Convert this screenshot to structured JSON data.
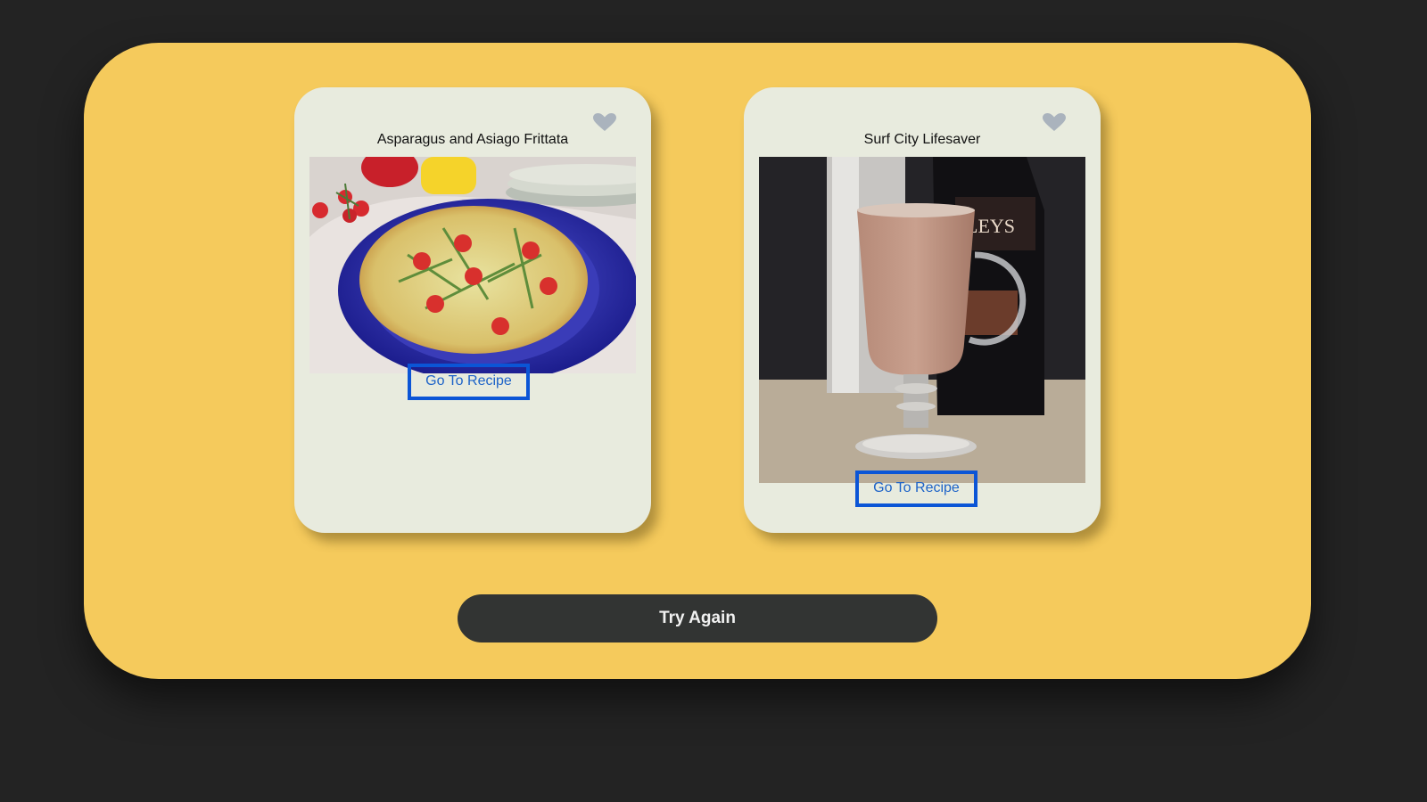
{
  "cards": [
    {
      "title": "Asparagus and Asiago Frittata",
      "link_label": "Go To Recipe",
      "icon": "heart-icon"
    },
    {
      "title": "Surf City Lifesaver",
      "link_label": "Go To Recipe",
      "icon": "heart-icon"
    }
  ],
  "actions": {
    "try_again_label": "Try Again"
  },
  "colors": {
    "background": "#232323",
    "panel": "#f5ca5c",
    "card": "#e8ebde",
    "link_border": "#0b55d6",
    "link_text": "#1d63c8",
    "button": "#323433",
    "heart": "#aab3bd"
  }
}
